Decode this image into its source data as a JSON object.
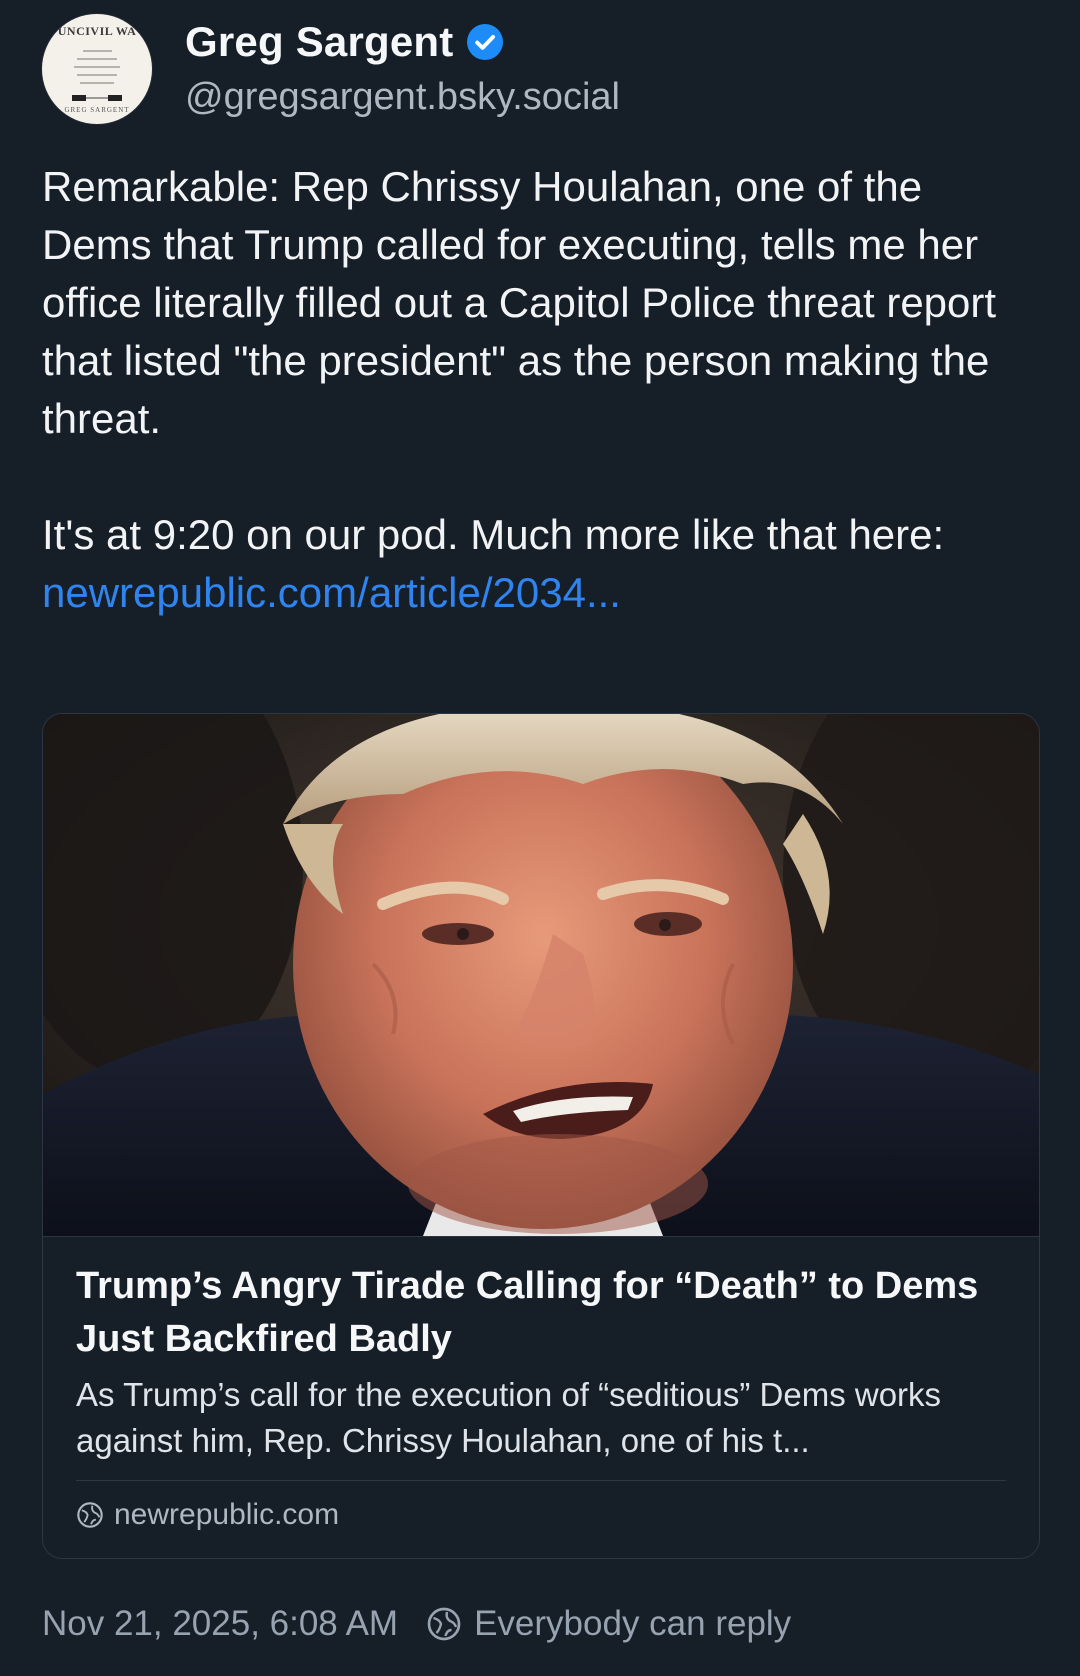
{
  "author": {
    "display_name": "Greg Sargent",
    "handle": "@gregsargent.bsky.social",
    "verified": true,
    "avatar_icon": "book-cover-avatar",
    "avatar_cover_title": "UNCIVIL WA",
    "avatar_cover_author": "GREG SARGENT"
  },
  "post": {
    "paragraph_1": "Remarkable: Rep Chrissy Houlahan, one of the Dems that Trump called for executing, tells me her office literally filled out a Capitol Police threat report that listed \"the president\" as the person making the threat.",
    "paragraph_2": "It's at 9:20 on our pod. Much more like that here:",
    "link_text": "newrepublic.com/article/2034..."
  },
  "link_card": {
    "image_subject": "photo-of-donald-trump-speaking",
    "title": "Trump’s Angry Tirade Calling for “Death” to Dems Just Backfired Badly",
    "description": "As Trump’s call for the execution of “seditious” Dems works against him, Rep. Chrissy Houlahan, one of his t...",
    "domain": "newrepublic.com",
    "domain_icon": "globe-icon"
  },
  "footer": {
    "timestamp": "Nov 21, 2025, 6:08 AM",
    "reply_setting": "Everybody can reply",
    "reply_icon": "reply-settings-icon"
  },
  "colors": {
    "background": "#161e27",
    "text_primary": "#f1f3f5",
    "text_secondary": "#aeb8c3",
    "link": "#2f84f0",
    "verified_badge": "#1d8cf8",
    "border": "#2c3744"
  }
}
